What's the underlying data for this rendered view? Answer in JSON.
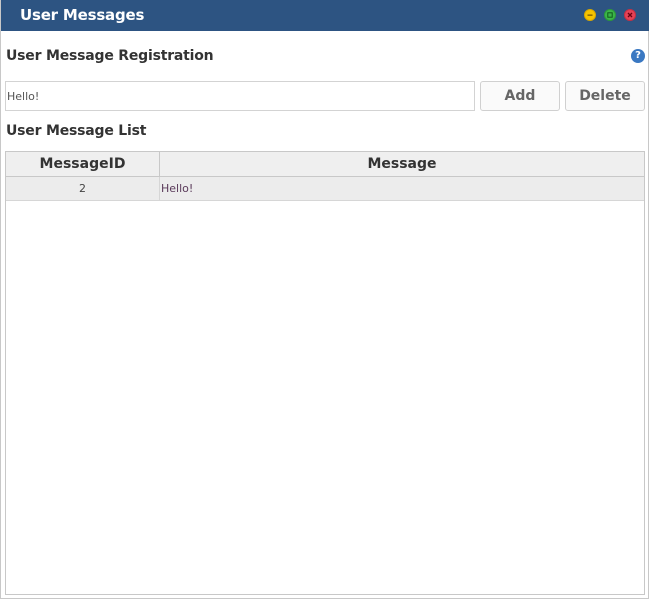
{
  "window": {
    "title": "User Messages",
    "controls": [
      "minimize",
      "restore",
      "close"
    ]
  },
  "registration": {
    "title": "User Message Registration",
    "help_icon": "?",
    "input_value": "Hello!",
    "add_label": "Add",
    "delete_label": "Delete"
  },
  "list": {
    "title": "User Message List",
    "columns": [
      "MessageID",
      "Message"
    ],
    "rows": [
      {
        "id": "2",
        "message": "Hello!"
      }
    ]
  },
  "colors": {
    "titlebar": "#2d5482",
    "minimize": "#f5c300",
    "maximize": "#3cb54a",
    "close": "#e54256",
    "help": "#3a78c2"
  }
}
